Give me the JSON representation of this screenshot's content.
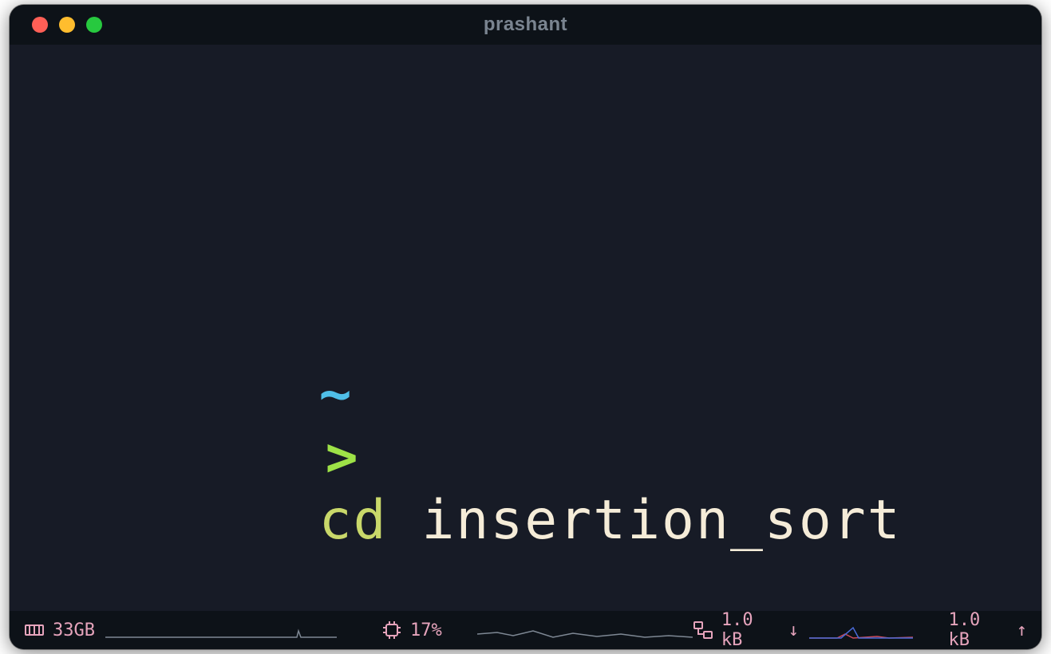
{
  "window": {
    "title": "prashant"
  },
  "prompt": {
    "path_symbol": "~",
    "prompt_symbol": ">",
    "command": "cd",
    "argument": "insertion_sort"
  },
  "status": {
    "memory": {
      "value": "33GB"
    },
    "cpu": {
      "value": "17%"
    },
    "net_down": {
      "value": "1.0 kB",
      "arrow": "↓"
    },
    "net_up": {
      "value": "1.0 kB",
      "arrow": "↑"
    }
  },
  "colors": {
    "tilde": "#4fbfe8",
    "arrow": "#9ee247",
    "cmd": "#c9d86a",
    "text": "#f5ecd8",
    "status": "#e6a4bc"
  }
}
